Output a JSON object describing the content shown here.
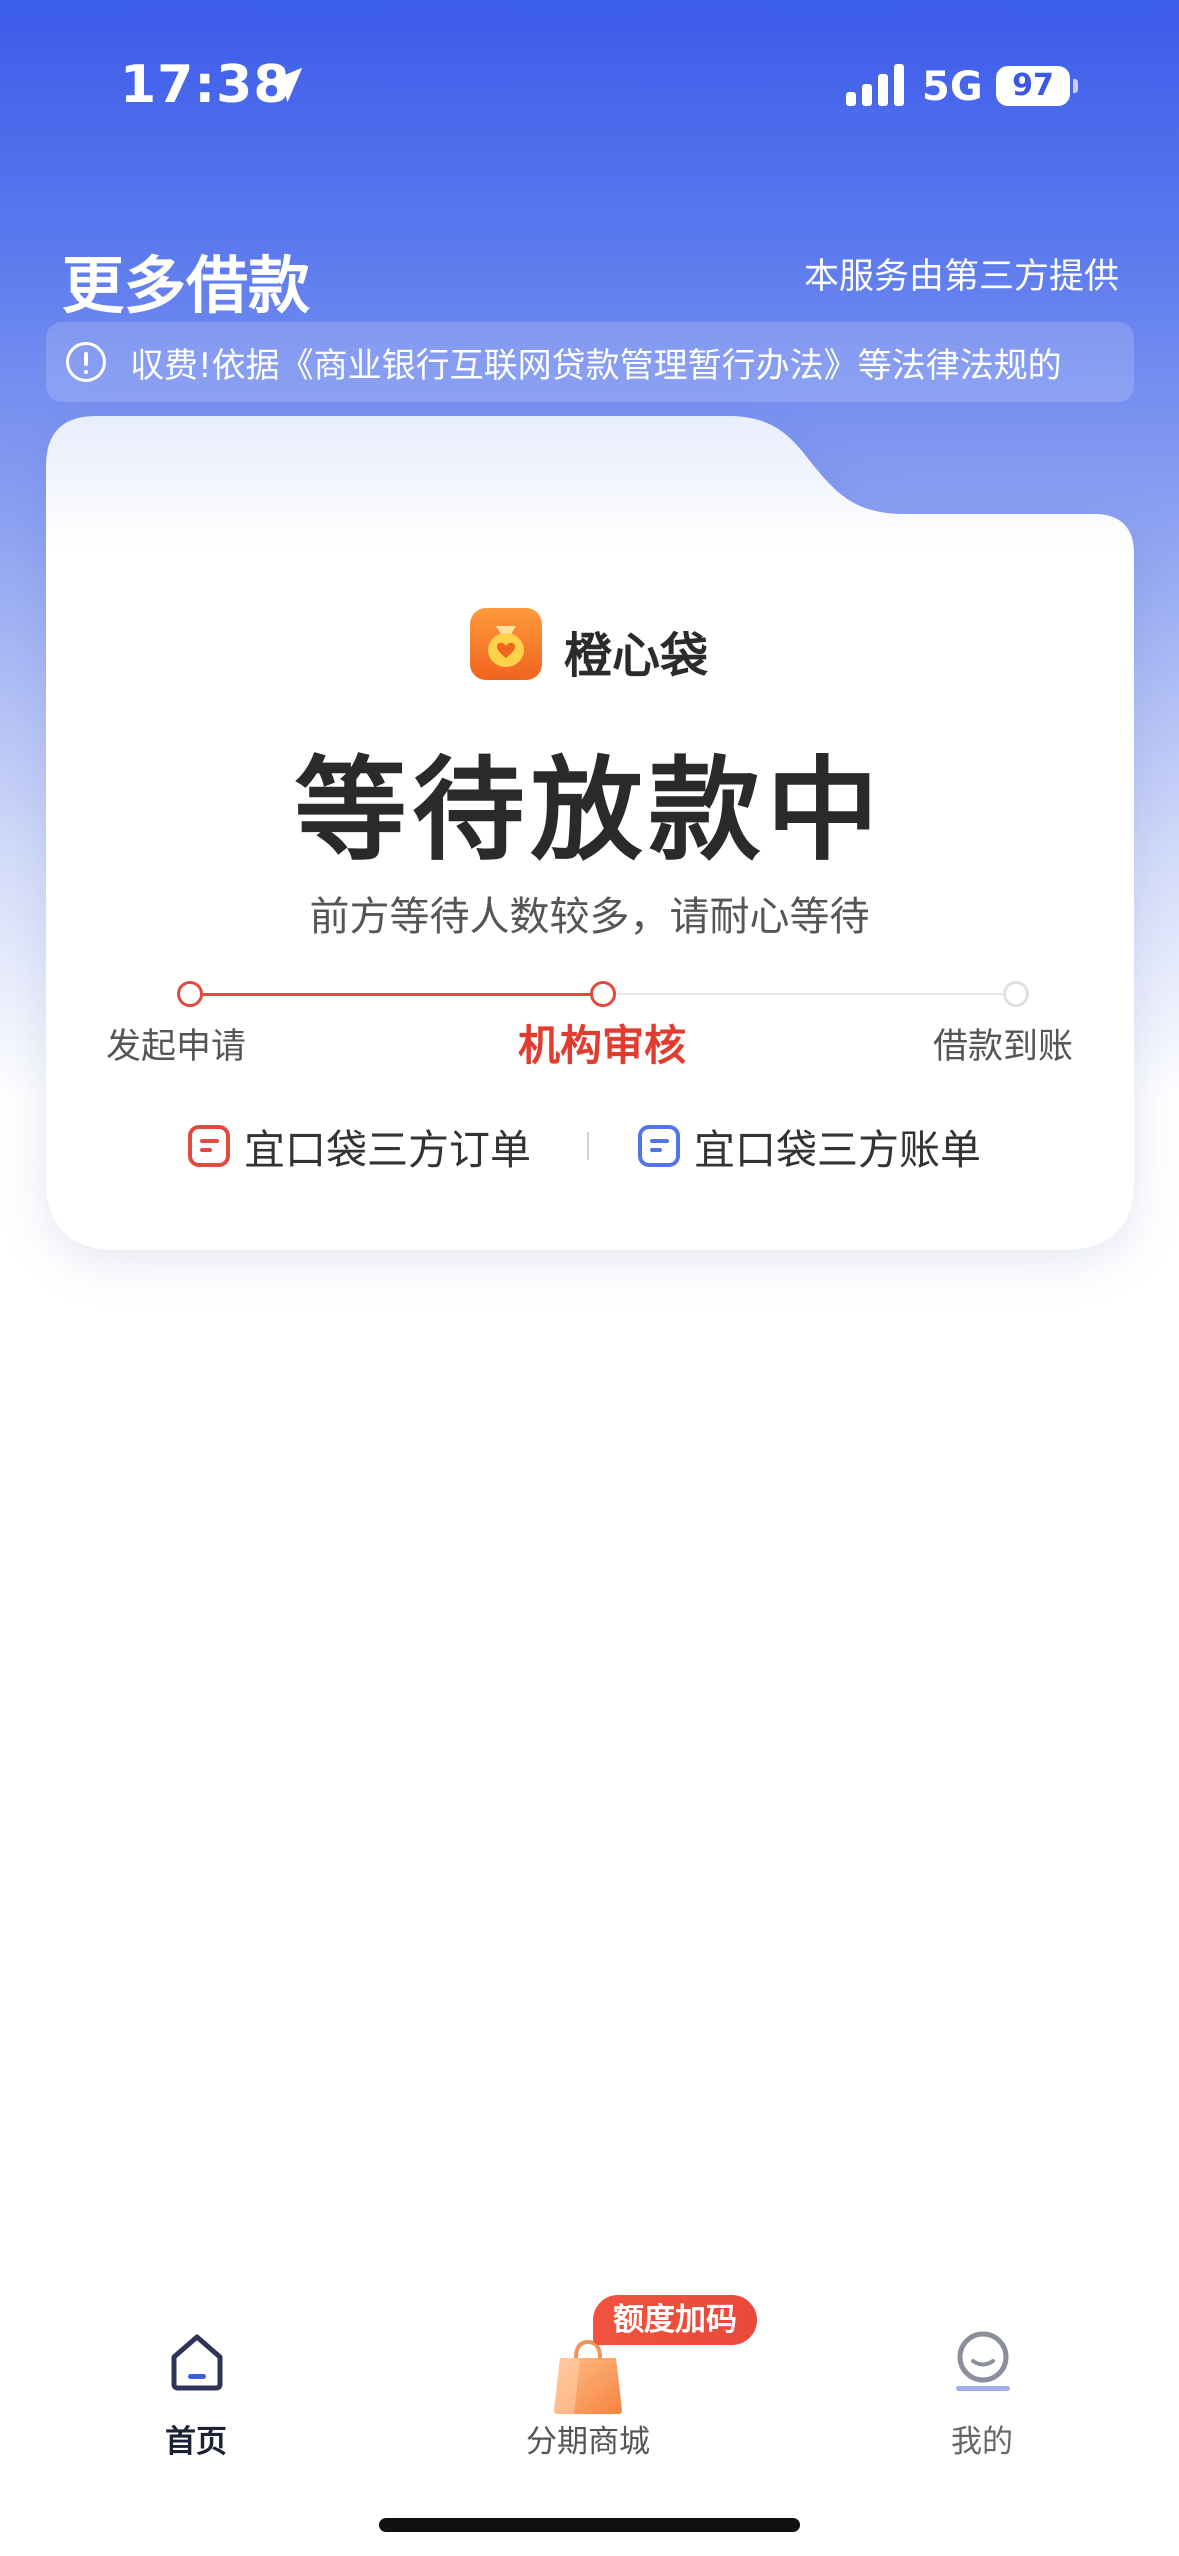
{
  "status_bar": {
    "time": "17:38",
    "network": "5G",
    "battery": "97"
  },
  "header": {
    "title": "更多借款",
    "provider_note": "本服务由第三方提供",
    "notice": "収费!依据《商业银行互联网贷款管理暂行办法》等法律法规的"
  },
  "card": {
    "brand": "橙心袋",
    "status_title": "等待放款中",
    "status_subtitle": "前方等待人数较多，请耐心等待",
    "steps": [
      {
        "label": "发起申请",
        "state": "done"
      },
      {
        "label": "机构审核",
        "state": "current"
      },
      {
        "label": "借款到账",
        "state": "pending"
      }
    ],
    "links": {
      "orders": "宜口袋三方订单",
      "bills": "宜口袋三方账单"
    }
  },
  "tab_bar": {
    "home": "首页",
    "mall": "分期商城",
    "me": "我的",
    "mall_badge": "额度加码"
  },
  "colors": {
    "accent": "#e24a3f",
    "brand_blue": "#3b5bea",
    "link_blue": "#5275e6"
  }
}
